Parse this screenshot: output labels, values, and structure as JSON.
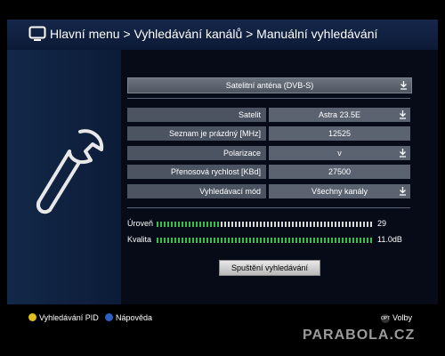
{
  "header": {
    "breadcrumb": "Hlavní menu > Vyhledávání kanálů > Manuální vyhledávání"
  },
  "antenna": {
    "value": "Satelitní anténa (DVB-S)"
  },
  "rows": [
    {
      "label": "Satelit",
      "value": "Astra 23.5E",
      "dropdown": true
    },
    {
      "label": "Seznam je prázdný [MHz]",
      "value": "12525",
      "dropdown": false
    },
    {
      "label": "Polarizace",
      "value": "v",
      "dropdown": true
    },
    {
      "label": "Přenosová rychlost [KBd]",
      "value": "27500",
      "dropdown": false
    },
    {
      "label": "Vyhledávací mód",
      "value": "Všechny kanály",
      "dropdown": true
    }
  ],
  "signal": {
    "level_label": "Úroveň",
    "level_value": "29",
    "level_fraction": 0.29,
    "quality_label": "Kvalita",
    "quality_value": "11.0dB",
    "quality_fraction": 1.0
  },
  "scan_button": "Spuštění vyhledávání",
  "footer": {
    "yellow_hint": "Vyhledávání PID",
    "blue_hint": "Nápověda",
    "opt_badge": "OPT",
    "options_hint": "Volby"
  },
  "watermark": "PARABOLA.CZ",
  "colors": {
    "meter_on": "#35c24a",
    "meter_off": "#d8d8d8",
    "yellow": "#e0c020",
    "blue": "#2a60c0"
  },
  "icons": {
    "tv": "tv-icon",
    "wrench": "wrench-icon",
    "dropdown": "dropdown-arrow-icon"
  }
}
